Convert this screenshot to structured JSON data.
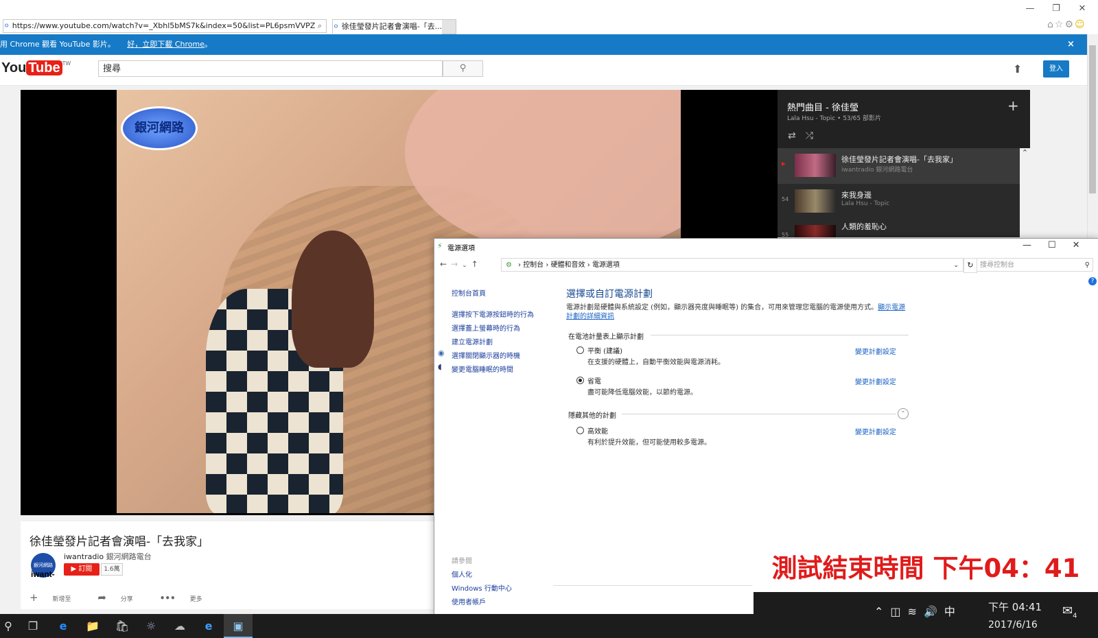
{
  "browser": {
    "url": "https://www.youtube.com/watch?v=_Xbhl5bMS7k&index=50&list=PL6psmVVPZ",
    "tab_label": "徐佳瑩發片記者會演唱-「去...",
    "tab_close": "×",
    "window_controls": [
      "—",
      "❐",
      "✕"
    ],
    "toolbar_icons": [
      "home-icon",
      "star-icon",
      "gear-icon",
      "smiley-icon"
    ]
  },
  "banner": {
    "text": "用 Chrome 觀看 YouTube 影片。",
    "link": "好，立即下載 Chrome",
    "suffix": "。",
    "close": "×",
    "color": "#167ac6"
  },
  "youtube": {
    "logo_you": "You",
    "logo_tube": "Tube",
    "region": "TW",
    "search_placeholder": "搜尋",
    "signin": "登入",
    "upload_icon": "upload-icon"
  },
  "video": {
    "title": "徐佳瑩發片記者會演唱-「去我家」",
    "channel_avatar_text": "銀河網路",
    "channel_brand": "iwant-",
    "channel_name": "iwantradio",
    "channel_name_zh": "銀河網路電台",
    "subscribe": "訂閱",
    "subscribers": "1.6萬",
    "watermark": "銀河網路",
    "actions": [
      {
        "icon": "+",
        "label": "新增至"
      },
      {
        "icon": "➦",
        "label": "分享"
      },
      {
        "icon": "•••",
        "label": "更多"
      }
    ]
  },
  "playlist": {
    "title": "熱門曲目 - 徐佳瑩",
    "subtitle": "Lala Hsu - Topic • 53/65 部影片",
    "add": "+",
    "items": [
      {
        "index": "▶",
        "title": "徐佳瑩發片記者會演唱-「去我家」",
        "author": "iwantradio 銀河網路電台"
      },
      {
        "index": "54",
        "title": "來我身邊",
        "author": "Lala Hsu - Topic"
      },
      {
        "index": "55",
        "title": "人類的羞恥心",
        "author": ""
      }
    ]
  },
  "power": {
    "window_title": "電源選項",
    "breadcrumb": [
      "控制台",
      "硬體和音效",
      "電源選項"
    ],
    "search_placeholder": "搜尋控制台",
    "left_nav": [
      "控制台首頁",
      "選擇按下電源按鈕時的行為",
      "選擇蓋上螢幕時的行為",
      "建立電源計劃",
      "選擇關閉顯示器的時機",
      "變更電腦睡眠的時間"
    ],
    "see_also_label": "請參閱",
    "see_also": [
      "個人化",
      "Windows 行動中心",
      "使用者帳戶"
    ],
    "heading": "選擇或自訂電源計劃",
    "description": "電源計劃是硬體與系統設定 (例如，顯示器亮度與睡眠等) 的集合，可用來管理您電腦的電源使用方式。",
    "description_link": "顯示電源計劃的詳細資訊",
    "group1": "在電池計量表上顯示計劃",
    "group2": "隱藏其他的計劃",
    "change_link": "變更計劃設定",
    "plans": [
      {
        "name": "平衡 (建議)",
        "desc": "在支援的硬體上，自動平衡效能與電源消耗。",
        "selected": false
      },
      {
        "name": "省電",
        "desc": "盡可能降低電腦效能，以節約電源。",
        "selected": true
      },
      {
        "name": "高效能",
        "desc": "有利於提升效能，但可能使用較多電源。",
        "selected": false
      }
    ]
  },
  "overlay": {
    "end_time": "測試結束時間 下午04：41",
    "color": "#e01b1b"
  },
  "taskbar": {
    "tray_lang": "中",
    "time": "下午 04:41",
    "date": "2017/6/16",
    "notifications": "4"
  }
}
